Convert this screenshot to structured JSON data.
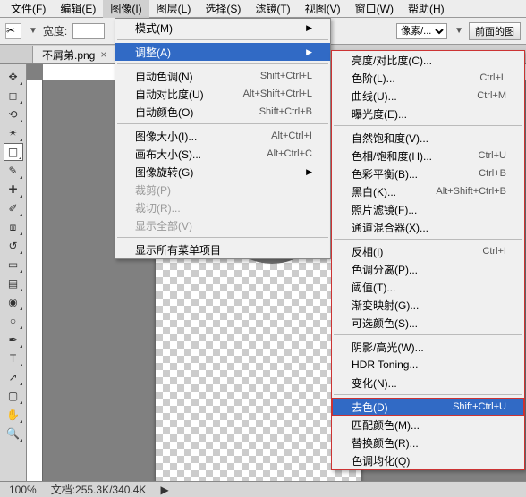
{
  "menubar": {
    "items": [
      {
        "label": "文件(F)"
      },
      {
        "label": "编辑(E)"
      },
      {
        "label": "图像(I)"
      },
      {
        "label": "图层(L)"
      },
      {
        "label": "选择(S)"
      },
      {
        "label": "滤镜(T)"
      },
      {
        "label": "视图(V)"
      },
      {
        "label": "窗口(W)"
      },
      {
        "label": "帮助(H)"
      }
    ]
  },
  "toolbar": {
    "width_label": "宽度:",
    "pixel_unit": "像素/...",
    "front_btn": "前面的图"
  },
  "tab": {
    "title": "不屑弟.png",
    "close": "×"
  },
  "status": {
    "zoom": "100%",
    "docinfo": "文档:255.3K/340.4K"
  },
  "menu1": {
    "items": [
      {
        "label": "模式(M)",
        "sub": true
      },
      {
        "sep": true
      },
      {
        "label": "调整(A)",
        "sub": true,
        "hl": true
      },
      {
        "sep": true
      },
      {
        "label": "自动色调(N)",
        "sc": "Shift+Ctrl+L"
      },
      {
        "label": "自动对比度(U)",
        "sc": "Alt+Shift+Ctrl+L"
      },
      {
        "label": "自动颜色(O)",
        "sc": "Shift+Ctrl+B"
      },
      {
        "sep": true
      },
      {
        "label": "图像大小(I)...",
        "sc": "Alt+Ctrl+I"
      },
      {
        "label": "画布大小(S)...",
        "sc": "Alt+Ctrl+C"
      },
      {
        "label": "图像旋转(G)",
        "sub": true
      },
      {
        "label": "裁剪(P)",
        "disabled": true
      },
      {
        "label": "裁切(R)...",
        "disabled": true
      },
      {
        "label": "显示全部(V)",
        "disabled": true
      },
      {
        "sep": true
      },
      {
        "label": "显示所有菜单项目"
      }
    ]
  },
  "menu2": {
    "items": [
      {
        "label": "亮度/对比度(C)..."
      },
      {
        "label": "色阶(L)...",
        "sc": "Ctrl+L"
      },
      {
        "label": "曲线(U)...",
        "sc": "Ctrl+M"
      },
      {
        "label": "曝光度(E)..."
      },
      {
        "sep": true
      },
      {
        "label": "自然饱和度(V)..."
      },
      {
        "label": "色相/饱和度(H)...",
        "sc": "Ctrl+U"
      },
      {
        "label": "色彩平衡(B)...",
        "sc": "Ctrl+B"
      },
      {
        "label": "黑白(K)...",
        "sc": "Alt+Shift+Ctrl+B"
      },
      {
        "label": "照片滤镜(F)..."
      },
      {
        "label": "通道混合器(X)..."
      },
      {
        "sep": true
      },
      {
        "label": "反相(I)",
        "sc": "Ctrl+I"
      },
      {
        "label": "色调分离(P)..."
      },
      {
        "label": "阈值(T)..."
      },
      {
        "label": "渐变映射(G)..."
      },
      {
        "label": "可选颜色(S)..."
      },
      {
        "sep": true
      },
      {
        "label": "阴影/高光(W)..."
      },
      {
        "label": "HDR Toning..."
      },
      {
        "label": "变化(N)..."
      },
      {
        "sep": true
      },
      {
        "label": "去色(D)",
        "sc": "Shift+Ctrl+U",
        "hl": true,
        "red": true
      },
      {
        "label": "匹配颜色(M)..."
      },
      {
        "label": "替换颜色(R)..."
      },
      {
        "label": "色调均化(Q)"
      }
    ]
  }
}
